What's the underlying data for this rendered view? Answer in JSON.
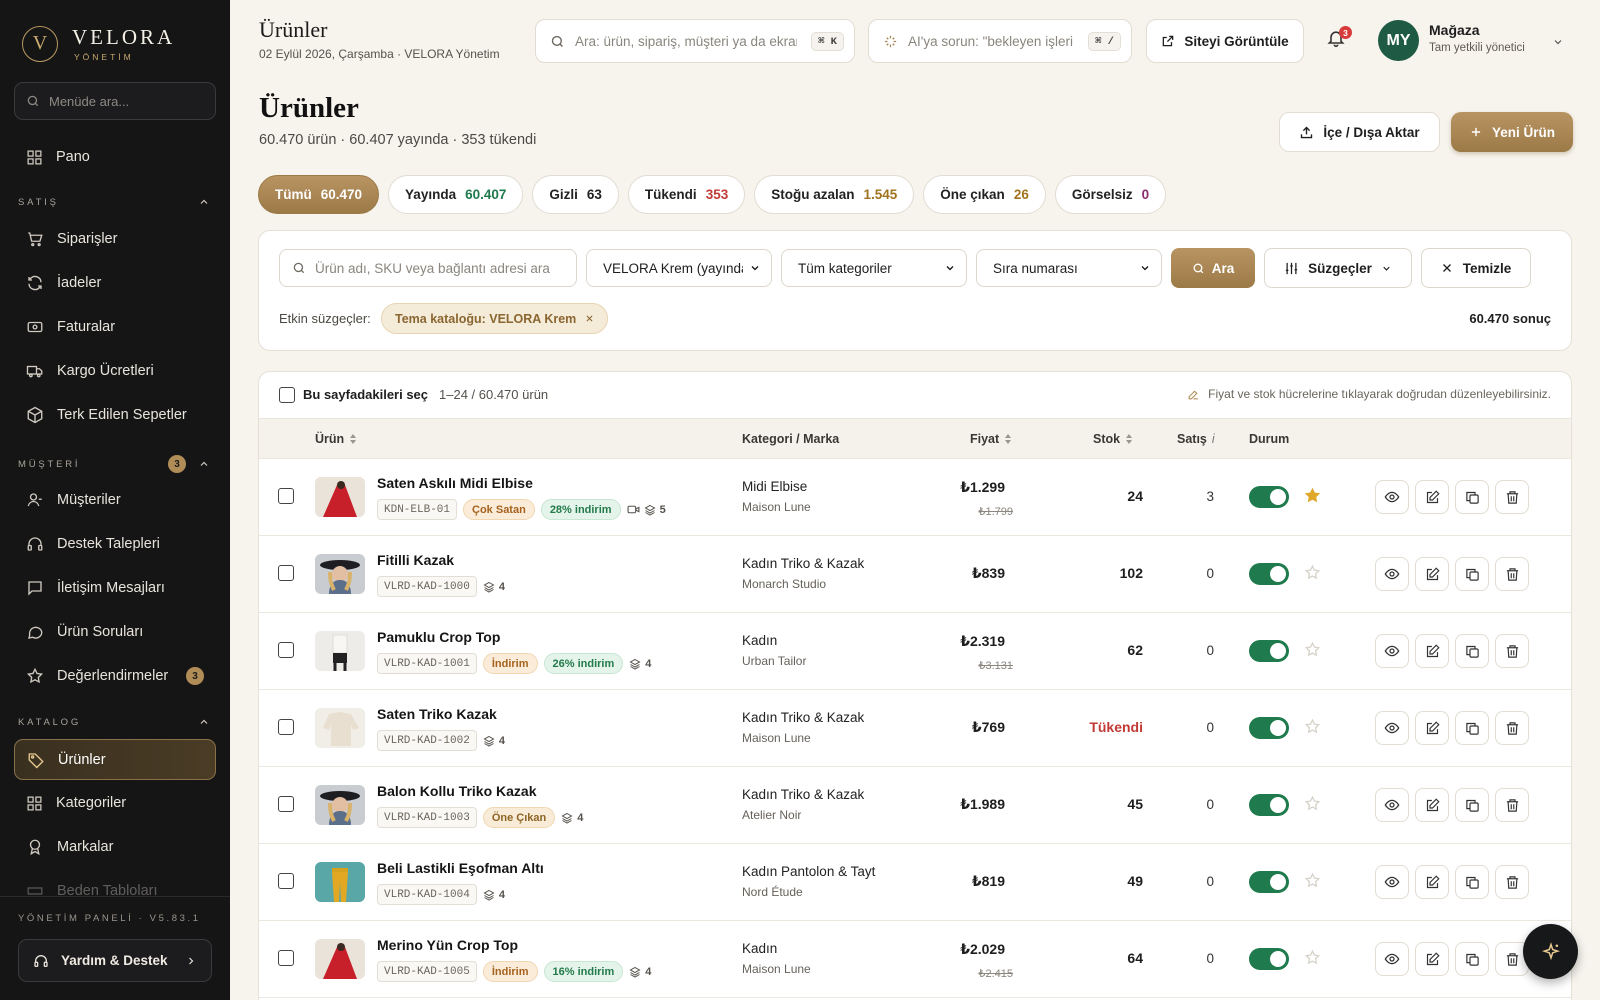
{
  "brand": {
    "mark": "V",
    "name": "VELORA",
    "sub": "YÖNETİM"
  },
  "sidebar": {
    "search_placeholder": "Menüde ara...",
    "pano": "Pano",
    "sections": [
      {
        "label": "SATIŞ",
        "items": [
          "Siparişler",
          "İadeler",
          "Faturalar",
          "Kargo Ücretleri",
          "Terk Edilen Sepetler"
        ]
      },
      {
        "label": "MÜŞTERİ",
        "count": "3",
        "items": [
          "Müşteriler",
          "Destek Talepleri",
          "İletişim Mesajları",
          "Ürün Soruları",
          "Değerlendirmeler"
        ],
        "reviews_count": "3"
      },
      {
        "label": "KATALOG",
        "items": [
          "Ürünler",
          "Kategoriler",
          "Markalar",
          "Beden Tabloları"
        ]
      }
    ],
    "version": "YÖNETİM PANELİ · V5.83.1",
    "help": "Yardım & Destek"
  },
  "topbar": {
    "title": "Ürünler",
    "date": "02 Eylül 2026, Çarşamba · VELORA Yönetim",
    "search_placeholder": "Ara: ürün, sipariş, müşteri ya da ekran",
    "search_kbd": "⌘ K",
    "ai_placeholder": "AI'ya sorun: \"bekleyen işleri",
    "ai_kbd": "⌘ /",
    "site_button": "Siteyi Görüntüle",
    "notifications": "3",
    "avatar": "MY",
    "user_name": "Mağaza",
    "user_role": "Tam yetkili yönetici"
  },
  "page": {
    "title": "Ürünler",
    "summary": "60.470 ürün · 60.407 yayında · 353 tükendi",
    "import_button": "İçe / Dışa Aktar",
    "new_button": "Yeni Ürün"
  },
  "tabs": [
    {
      "label": "Tümü",
      "count": "60.470",
      "color": "#ffffff"
    },
    {
      "label": "Yayında",
      "count": "60.407",
      "color": "#1f7a4d"
    },
    {
      "label": "Gizli",
      "count": "63",
      "color": "#222222"
    },
    {
      "label": "Tükendi",
      "count": "353",
      "color": "#c23a35"
    },
    {
      "label": "Stoğu azalan",
      "count": "1.545",
      "color": "#a0731f"
    },
    {
      "label": "Öne çıkan",
      "count": "26",
      "color": "#a0731f"
    },
    {
      "label": "Görselsiz",
      "count": "0",
      "color": "#8a2f6a"
    }
  ],
  "filters": {
    "search_placeholder": "Ürün adı, SKU veya bağlantı adresi ara",
    "theme": "VELORA Krem (yayında",
    "category": "Tüm kategoriler",
    "sort": "Sıra numarası",
    "search_button": "Ara",
    "filters_button": "Süzgeçler",
    "clear_button": "Temizle",
    "active_label": "Etkin süzgeçler:",
    "active_chip": "Tema kataloğu: VELORA Krem",
    "result_count": "60.470 sonuç"
  },
  "table": {
    "select_label": "Bu sayfadakileri seç",
    "range": "1–24 / 60.470 ürün",
    "edit_hint": "Fiyat ve stok hücrelerine tıklayarak doğrudan düzenleyebilirsiniz.",
    "headers": {
      "product": "Ürün",
      "category": "Kategori / Marka",
      "price": "Fiyat",
      "stock": "Stok",
      "sales": "Satış",
      "status": "Durum"
    },
    "rows": [
      {
        "name": "Saten Askılı Midi Elbise",
        "sku": "KDN-ELB-01",
        "badges": [
          {
            "t": "Çok Satan",
            "c": "orange"
          },
          {
            "t": "28% indirim",
            "c": "green"
          }
        ],
        "video": true,
        "variants": "5",
        "category": "Midi Elbise",
        "brand": "Maison Lune",
        "price": "₺1.299",
        "old_price": "₺1.799",
        "stock": "24",
        "sales": "3",
        "featured": true,
        "thumb": "red"
      },
      {
        "name": "Fitilli Kazak",
        "sku": "VLRD-KAD-1000",
        "badges": [],
        "video": false,
        "variants": "4",
        "category": "Kadın Triko & Kazak",
        "brand": "Monarch Studio",
        "price": "₺839",
        "old_price": "",
        "stock": "102",
        "sales": "0",
        "featured": false,
        "thumb": "hat"
      },
      {
        "name": "Pamuklu Crop Top",
        "sku": "VLRD-KAD-1001",
        "badges": [
          {
            "t": "İndirim",
            "c": "orange"
          },
          {
            "t": "26% indirim",
            "c": "green"
          }
        ],
        "video": false,
        "variants": "4",
        "category": "Kadın",
        "brand": "Urban Tailor",
        "price": "₺2.319",
        "old_price": "₺3.131",
        "stock": "62",
        "sales": "0",
        "featured": false,
        "thumb": "white"
      },
      {
        "name": "Saten Triko Kazak",
        "sku": "VLRD-KAD-1002",
        "badges": [],
        "video": false,
        "variants": "4",
        "category": "Kadın Triko & Kazak",
        "brand": "Maison Lune",
        "price": "₺769",
        "old_price": "",
        "stock": "Tükendi",
        "sales": "0",
        "featured": false,
        "thumb": "cream"
      },
      {
        "name": "Balon Kollu Triko Kazak",
        "sku": "VLRD-KAD-1003",
        "badges": [
          {
            "t": "Öne Çıkan",
            "c": "gold"
          }
        ],
        "video": false,
        "variants": "4",
        "category": "Kadın Triko & Kazak",
        "brand": "Atelier Noir",
        "price": "₺1.989",
        "old_price": "",
        "stock": "45",
        "sales": "0",
        "featured": false,
        "thumb": "hat"
      },
      {
        "name": "Beli Lastikli Eşofman Altı",
        "sku": "VLRD-KAD-1004",
        "badges": [],
        "video": false,
        "variants": "4",
        "category": "Kadın Pantolon & Tayt",
        "brand": "Nord Étude",
        "price": "₺819",
        "old_price": "",
        "stock": "49",
        "sales": "0",
        "featured": false,
        "thumb": "yellow"
      },
      {
        "name": "Merino Yün Crop Top",
        "sku": "VLRD-KAD-1005",
        "badges": [
          {
            "t": "İndirim",
            "c": "orange"
          },
          {
            "t": "16% indirim",
            "c": "green"
          }
        ],
        "video": false,
        "variants": "4",
        "category": "Kadın",
        "brand": "Maison Lune",
        "price": "₺2.029",
        "old_price": "₺2.415",
        "stock": "64",
        "sales": "0",
        "featured": false,
        "thumb": "red"
      }
    ]
  },
  "colors": {
    "accent": "#a8864f",
    "sidebar": "#151516",
    "success": "#1f7a4d",
    "danger": "#c23a35"
  }
}
